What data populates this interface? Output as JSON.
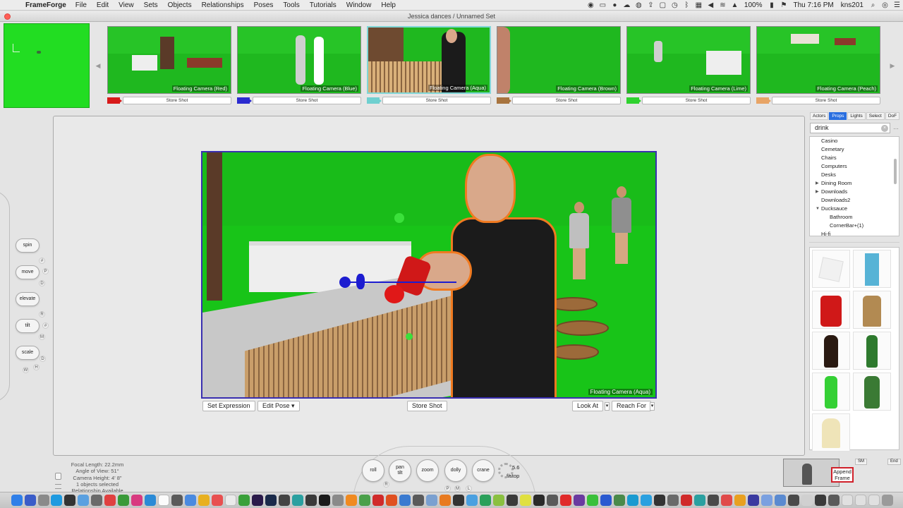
{
  "menubar": {
    "app_name": "FrameForge",
    "menus": [
      "File",
      "Edit",
      "View",
      "Sets",
      "Objects",
      "Relationships",
      "Poses",
      "Tools",
      "Tutorials",
      "Window",
      "Help"
    ],
    "battery": "100%",
    "clock": "Thu 7:16 PM",
    "user": "kns201"
  },
  "window": {
    "title": "Jessica dances / Unnamed Set"
  },
  "filmstrip": {
    "store_label": "Store Shot",
    "shots": [
      {
        "camera": "Floating Camera (Red)",
        "color": "#d81a1a",
        "selected": false
      },
      {
        "camera": "Floating Camera (Blue)",
        "color": "#2b2bd0",
        "selected": false
      },
      {
        "camera": "Floating Camera (Aqua)",
        "color": "#6fd0d0",
        "selected": true
      },
      {
        "camera": "Floating Camera (Brown)",
        "color": "#a8743f",
        "selected": false
      },
      {
        "camera": "Floating Camera (Lime)",
        "color": "#2fd22f",
        "selected": false
      },
      {
        "camera": "Floating Camera (Peach)",
        "color": "#e8a466",
        "selected": false
      }
    ]
  },
  "viewport": {
    "camera_label": "Floating Camera (Aqua)",
    "buttons": {
      "set_expression": "Set Expression",
      "edit_pose": "Edit Pose",
      "store_shot": "Store Shot",
      "look_at": "Look At",
      "reach_for": "Reach For"
    }
  },
  "left_controls": {
    "spin": "spin",
    "move": "move",
    "elevate": "elevate",
    "tilt": "tilt",
    "scale": "scale",
    "keys": [
      "#",
      "P",
      "D",
      "R",
      "#",
      "M",
      "D",
      "W",
      "H"
    ]
  },
  "right_panel": {
    "tabs": [
      "Actors",
      "Props",
      "Lights",
      "Select",
      "DoF"
    ],
    "active_tab": "Props",
    "search_value": "drink",
    "tree": [
      {
        "label": "Casino",
        "level": 0,
        "arrow": ""
      },
      {
        "label": "Cemetary",
        "level": 0,
        "arrow": ""
      },
      {
        "label": "Chairs",
        "level": 0,
        "arrow": ""
      },
      {
        "label": "Computers",
        "level": 0,
        "arrow": ""
      },
      {
        "label": "Desks",
        "level": 0,
        "arrow": ""
      },
      {
        "label": "Dining Room",
        "level": 0,
        "arrow": "▶"
      },
      {
        "label": "Downloads",
        "level": 0,
        "arrow": "▶"
      },
      {
        "label": "Downloads2",
        "level": 0,
        "arrow": ""
      },
      {
        "label": "Ducksauce",
        "level": 0,
        "arrow": "▼"
      },
      {
        "label": "Bathroom",
        "level": 1,
        "arrow": ""
      },
      {
        "label": "CornerBar+(1)",
        "level": 1,
        "arrow": ""
      },
      {
        "label": "Hi-fi",
        "level": 0,
        "arrow": ""
      }
    ],
    "props": [
      "ice-cube",
      "blue-carton",
      "cola-can",
      "paper-bag",
      "whiskey-bottle",
      "green-bottle",
      "green-champagne",
      "champagne-bottle",
      "cream-cylinder"
    ]
  },
  "camera_info": {
    "focal_length": "Focal Length: 22.2mm",
    "angle_of_view": "Angle of View: 51°",
    "camera_height": "Camera Height: 4' 8\"",
    "selection": "1 objects selected",
    "relationship": "Relationship Available"
  },
  "camera_controls": {
    "roll": "roll",
    "pan_tilt": "pan\ntilt",
    "zoom": "zoom",
    "dolly": "dolly",
    "crane": "crane",
    "fstop_value": "5.6",
    "fstop_label": "f/stop",
    "keys": [
      "R",
      "P",
      "M",
      "L"
    ]
  },
  "sequence": {
    "tabs": [
      "SM",
      "End"
    ],
    "append_label": "Append Frame"
  },
  "colors": {
    "greenscreen": "#22dd22",
    "selection_outline": "#f07a20",
    "viewport_border": "#3a2fb0",
    "active_tab": "#2a6fe0"
  }
}
